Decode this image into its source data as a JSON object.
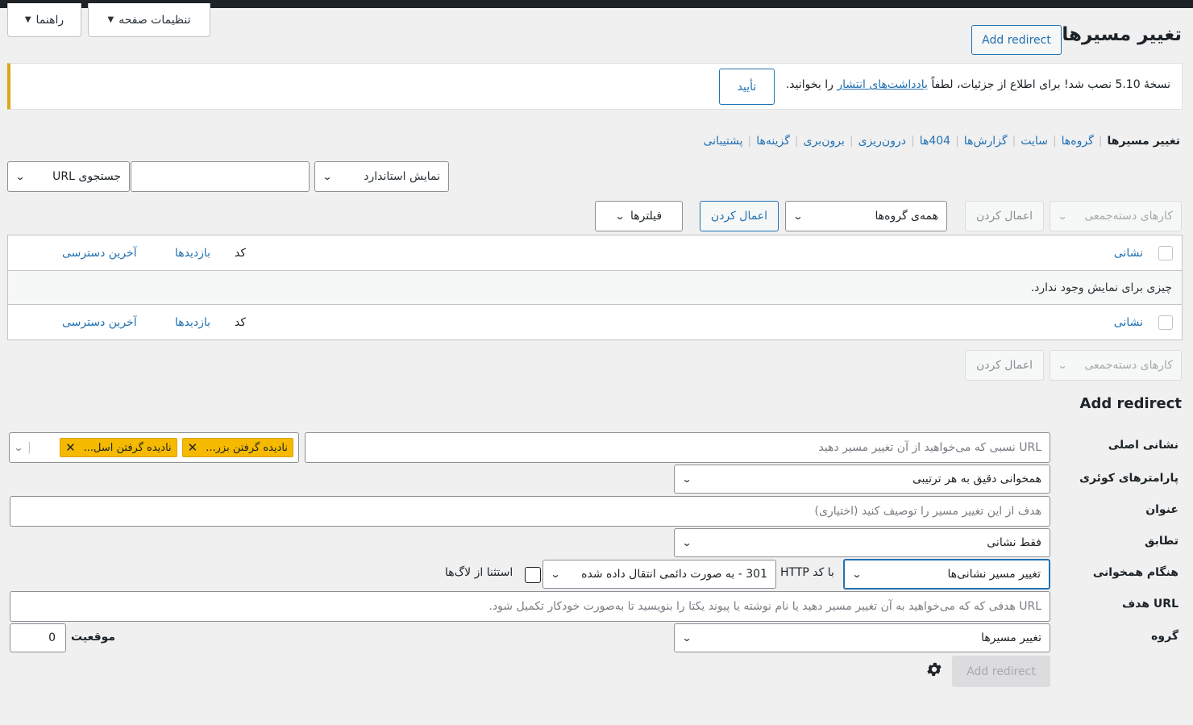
{
  "header": {
    "help_label": "راهنما",
    "screen_options_label": "تنظیمات صفحه",
    "page_title": "تغییر مسیرها",
    "add_redirect_label": "Add redirect"
  },
  "notice": {
    "text_before": "نسخهٔ 5.10 نصب شد! برای اطلاع از جزئیات، لطفاً",
    "link": "یادداشت‌های انتشار",
    "text_after": "را بخوانید.",
    "confirm_label": "تأیید"
  },
  "subnav": [
    "تغییر مسیرها",
    "گروه‌ها",
    "سایت",
    "گزارش‌ها",
    "404ها",
    "درون‌ریزی",
    "برون‌بری",
    "گزینه‌ها",
    "پشتیبانی"
  ],
  "search": {
    "display_select": "نمایش استاندارد",
    "search_select": "جستجوی URL",
    "input_value": ""
  },
  "toolbar": {
    "bulk_actions": "کارهای دسته‌جمعی",
    "apply": "اعمال کردن",
    "groups_select": "همه‌ی گروه‌ها",
    "apply_groups": "اعمال کردن",
    "filters": "فیلترها"
  },
  "table": {
    "col_url": "نشانی",
    "col_code": "کد",
    "col_hits": "بازدیدها",
    "col_last": "آخرین دسترسی",
    "empty": "چیزی برای نمایش وجود ندارد."
  },
  "bottom_toolbar": {
    "bulk_actions": "کارهای دسته‌جمعی",
    "apply": "اعمال کردن"
  },
  "form": {
    "title": "Add redirect",
    "source_label": "نشانی اصلی",
    "source_placeholder": "URL نسبی که می‌خواهید از آن تغییر مسیر دهید",
    "chip1": "نادیده گرفتن بزر...",
    "chip2": "نادیده گرفتن اسل...",
    "query_label": "پارامترهای کوئری",
    "query_select": "همخوانی دقیق به هر ترتیبی",
    "title_label": "عنوان",
    "title_placeholder": "هدف از این تغییر مسیر را توصیف کنید (اختیاری)",
    "match_label": "تطابق",
    "match_select": "فقط نشانی",
    "when_label": "هنگام همخوانی",
    "action_select": "تغییر مسیر نشانی‌ها",
    "http_code_label": "با کد HTTP",
    "http_code_select": "301 - به صورت دائمی انتقال داده شده",
    "exclude_logs_label": "استثنا از لاگ‌ها",
    "target_label": "URL هدف",
    "target_placeholder": "URL هدفی که که می‌خواهید به آن تغییر مسیر دهید یا نام نوشته یا پیوند یکتا را بنویسید تا به‌صورت خودکار تکمیل شود.",
    "group_label": "گروه",
    "group_select": "تغییر مسیرها",
    "position_label": "موقعیت",
    "position_value": "0",
    "submit_label": "Add redirect"
  },
  "colors": {
    "accent": "#2271b1",
    "notice_border": "#dba617",
    "chip": "#f5b900"
  }
}
